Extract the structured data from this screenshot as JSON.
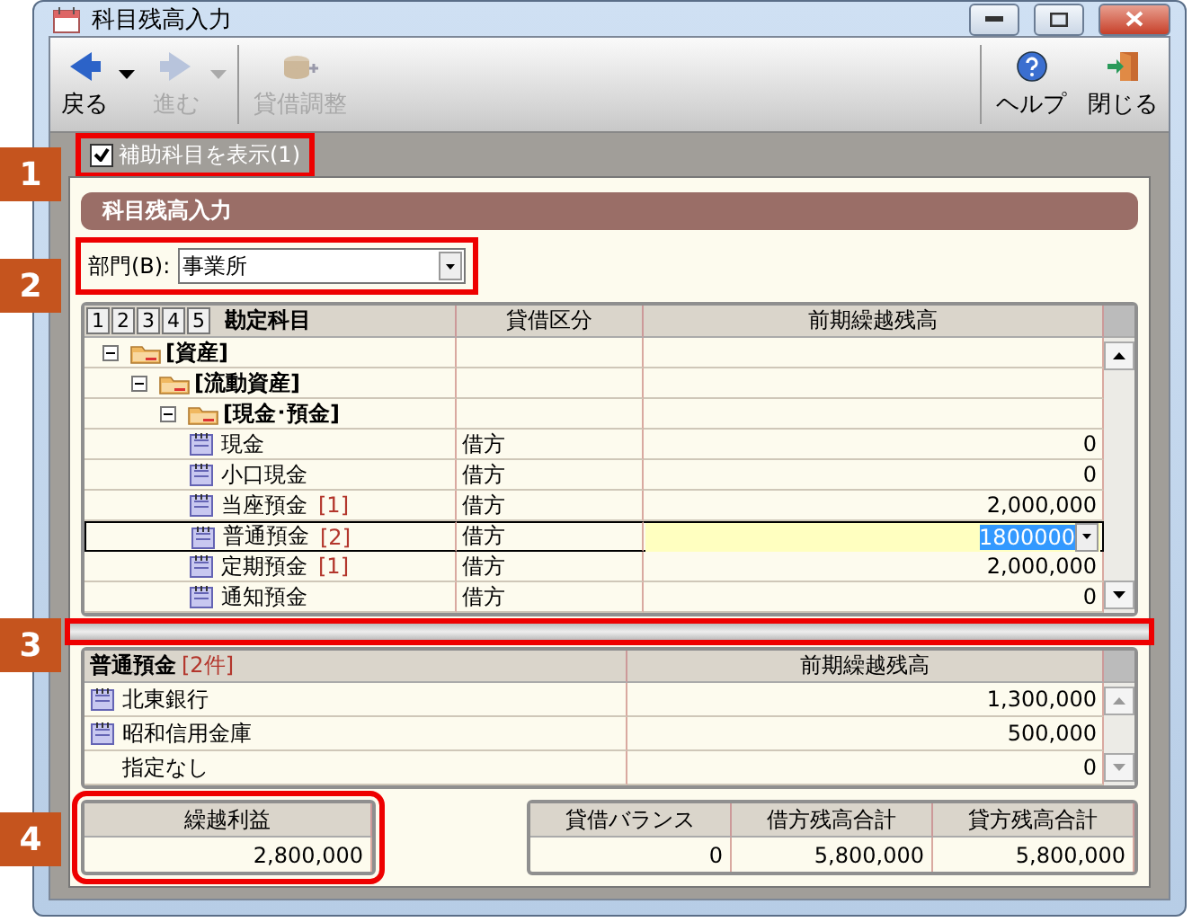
{
  "window": {
    "title": "科目残高入力"
  },
  "toolbar": {
    "left": [
      {
        "kind": "back",
        "label": "戻る",
        "disabled": false,
        "dropdown": true
      },
      {
        "kind": "forward",
        "label": "進む",
        "disabled": true,
        "dropdown": true
      },
      {
        "kind": "adjust",
        "label": "貸借調整",
        "disabled": true,
        "dropdown": false
      }
    ],
    "right": [
      {
        "kind": "help",
        "label": "ヘルプ"
      },
      {
        "kind": "exit",
        "label": "閉じる"
      }
    ]
  },
  "show_sub_accounts": {
    "label": "補助科目を表示(1)",
    "checked": true
  },
  "panel_title": "科目残高入力",
  "department": {
    "label": "部門(B):",
    "value": "事業所"
  },
  "level_buttons": [
    "1",
    "2",
    "3",
    "4",
    "5"
  ],
  "tree": {
    "columns": [
      "勘定科目",
      "貸借区分",
      "前期繰越残高"
    ],
    "rows": [
      {
        "name": "[資産]",
        "expanded": true,
        "selected": false,
        "children": [
          {
            "name": "[流動資産]",
            "expanded": true,
            "selected": false,
            "children": [
              {
                "name": "[現金･預金]",
                "expanded": true,
                "selected": false,
                "children": [
                  {
                    "name": "現金",
                    "side": "借方",
                    "balance": "0",
                    "selected": false
                  },
                  {
                    "name": "小口現金",
                    "side": "借方",
                    "balance": "0",
                    "selected": false
                  },
                  {
                    "name": "当座預金",
                    "count": "[1]",
                    "side": "借方",
                    "balance": "2,000,000",
                    "selected": false
                  },
                  {
                    "name": "普通預金",
                    "count": "[2]",
                    "side": "借方",
                    "balance": "1800000",
                    "selected": true
                  },
                  {
                    "name": "定期預金",
                    "count": "[1]",
                    "side": "借方",
                    "balance": "2,000,000",
                    "selected": false
                  },
                  {
                    "name": "通知預金",
                    "side": "借方",
                    "balance": "0",
                    "selected": false
                  }
                ]
              }
            ]
          }
        ]
      }
    ]
  },
  "sub_table": {
    "title": "普通預金",
    "count": "[2件]",
    "column": "前期繰越残高",
    "rows": [
      {
        "kind": "bank",
        "name": "北東銀行",
        "balance": "1,300,000"
      },
      {
        "kind": "bank",
        "name": "昭和信用金庫",
        "balance": "500,000"
      },
      {
        "kind": "none",
        "name": "指定なし",
        "balance": "0"
      }
    ]
  },
  "carry_forward": {
    "label": "繰越利益",
    "value": "2,800,000"
  },
  "totals": [
    {
      "label": "貸借バランス",
      "value": "0"
    },
    {
      "label": "借方残高合計",
      "value": "5,800,000"
    },
    {
      "label": "貸方残高合計",
      "value": "5,800,000"
    }
  ],
  "callouts": [
    "1",
    "2",
    "3",
    "4"
  ]
}
